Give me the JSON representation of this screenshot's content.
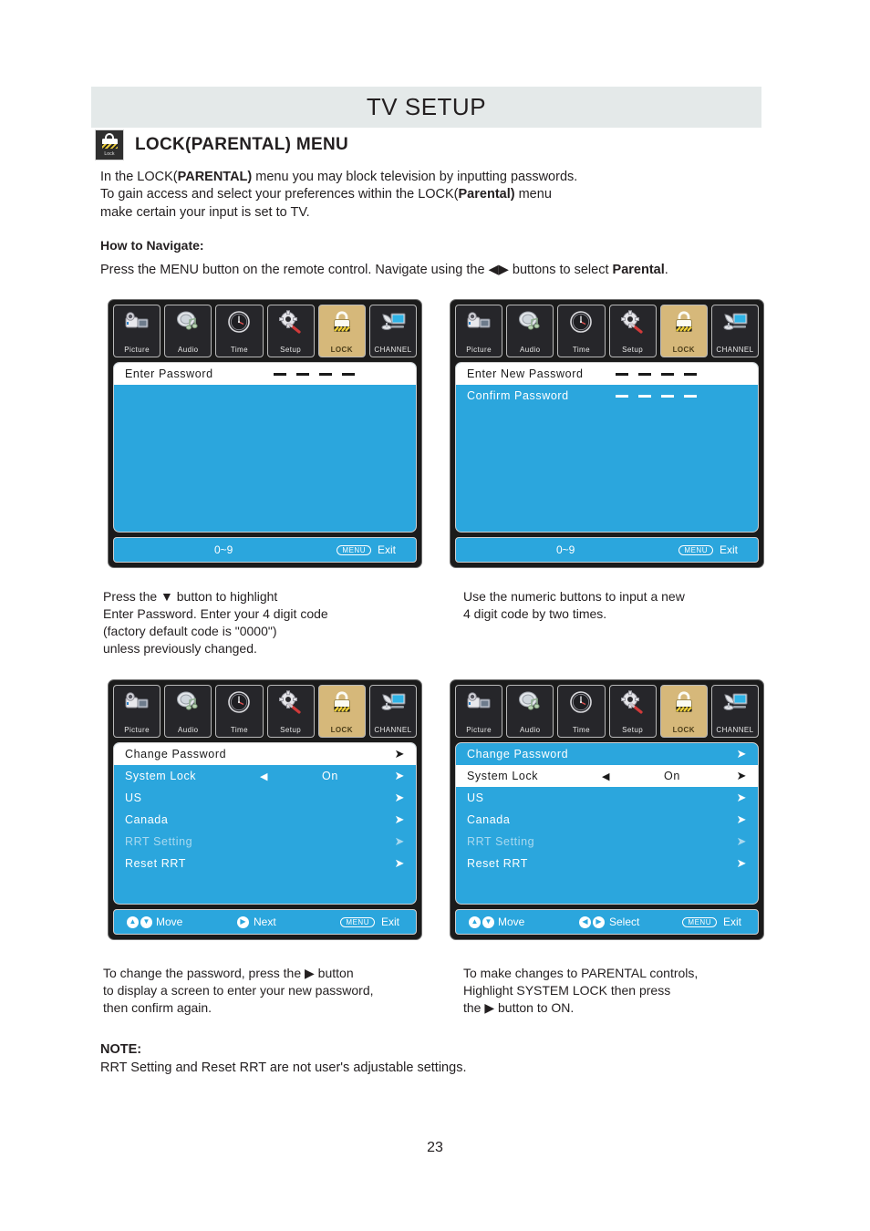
{
  "header": {
    "title": "TV SETUP"
  },
  "section": {
    "icon": "lock-icon",
    "icon_caption": "Lock",
    "title": "LOCK(PARENTAL) MENU"
  },
  "intro": {
    "line1_a": "In the LOCK(",
    "line1_b": "PARENTAL)",
    "line1_c": " menu you may block television by inputting passwords.",
    "line2_a": "To gain access and select your preferences within the LOCK(",
    "line2_b": "Parental)",
    "line2_c": " menu",
    "line3": "make certain your input is set to TV."
  },
  "howto": {
    "label": "How to Navigate:",
    "text_a": "Press the MENU button on the remote control. Navigate using the ",
    "arrows": "◀▶",
    "text_b": " buttons to select ",
    "bold": "Parental",
    "text_c": "."
  },
  "tabs": [
    {
      "label": "Picture",
      "icon": "camcorder-icon",
      "active": false
    },
    {
      "label": "Audio",
      "icon": "speaker-music-icon",
      "active": false
    },
    {
      "label": "Time",
      "icon": "clock-icon",
      "active": false
    },
    {
      "label": "Setup",
      "icon": "gear-screwdriver-icon",
      "active": false
    },
    {
      "label": "LOCK",
      "icon": "padlock-icon",
      "active": true
    },
    {
      "label": "CHANNEL",
      "icon": "dish-monitor-icon",
      "active": false
    }
  ],
  "osd1": {
    "rows": [
      {
        "label": "Enter Password",
        "highlighted": true,
        "dashes": 4
      }
    ],
    "footer": {
      "left": "0~9",
      "menu_pill": "MENU",
      "exit": "Exit"
    }
  },
  "osd2": {
    "rows": [
      {
        "label": "Enter New Password",
        "highlighted": true,
        "dashes": 4
      },
      {
        "label": "Confirm Password",
        "highlighted": false,
        "dashes": 4
      }
    ],
    "footer": {
      "left": "0~9",
      "menu_pill": "MENU",
      "exit": "Exit"
    }
  },
  "osd3": {
    "rows": [
      {
        "label": "Change Password",
        "highlighted": true,
        "dim": false,
        "arrow": "➤",
        "left_arrow": "",
        "value": ""
      },
      {
        "label": "System Lock",
        "highlighted": false,
        "dim": false,
        "arrow": "➤",
        "left_arrow": "◀",
        "value": "On"
      },
      {
        "label": "US",
        "highlighted": false,
        "dim": false,
        "arrow": "➤",
        "left_arrow": "",
        "value": ""
      },
      {
        "label": "Canada",
        "highlighted": false,
        "dim": false,
        "arrow": "➤",
        "left_arrow": "",
        "value": ""
      },
      {
        "label": "RRT Setting",
        "highlighted": false,
        "dim": true,
        "arrow": "➤",
        "left_arrow": "",
        "value": ""
      },
      {
        "label": "Reset RRT",
        "highlighted": false,
        "dim": false,
        "arrow": "➤",
        "left_arrow": "",
        "value": ""
      }
    ],
    "footer": {
      "move": "Move",
      "middle": "Next",
      "menu_pill": "MENU",
      "exit": "Exit"
    }
  },
  "osd4": {
    "rows": [
      {
        "label": "Change Password",
        "highlighted": false,
        "dim": false,
        "arrow": "➤",
        "left_arrow": "",
        "value": ""
      },
      {
        "label": "System Lock",
        "highlighted": true,
        "dim": false,
        "arrow": "➤",
        "left_arrow": "◀",
        "value": "On"
      },
      {
        "label": "US",
        "highlighted": false,
        "dim": false,
        "arrow": "➤",
        "left_arrow": "",
        "value": ""
      },
      {
        "label": "Canada",
        "highlighted": false,
        "dim": false,
        "arrow": "➤",
        "left_arrow": "",
        "value": ""
      },
      {
        "label": "RRT Setting",
        "highlighted": false,
        "dim": true,
        "arrow": "➤",
        "left_arrow": "",
        "value": ""
      },
      {
        "label": "Reset RRT",
        "highlighted": false,
        "dim": false,
        "arrow": "➤",
        "left_arrow": "",
        "value": ""
      }
    ],
    "footer": {
      "move": "Move",
      "middle": "Select",
      "menu_pill": "MENU",
      "exit": "Exit"
    }
  },
  "captions": {
    "c1": "Press the ▼ button to highlight\nEnter Password. Enter your 4 digit code\n(factory default code is \"0000\")\nunless previously changed.",
    "c2": "Use the numeric buttons to input a new\n4 digit code by two times.",
    "c3": "To change the password, press the ▶ button\nto display a screen to enter your new password,\nthen confirm again.",
    "c4": "To make changes to PARENTAL controls,\nHighlight SYSTEM LOCK then press\nthe ▶ button to ON."
  },
  "note": {
    "label": "NOTE:",
    "text": "RRT Setting and Reset RRT are not user's adjustable settings."
  },
  "page_number": "23",
  "colors": {
    "header_band": "#e4e9e9",
    "osd_blue": "#2ba6dd",
    "osd_frame": "#1b1b1b",
    "tab_active": "#d6b87a",
    "tab_bg": "#26262a",
    "text": "#231f20"
  }
}
